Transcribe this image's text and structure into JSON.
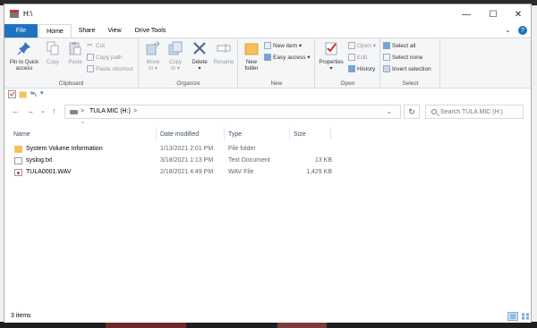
{
  "window": {
    "title": "H:\\",
    "controls": {
      "minimize": "—",
      "maximize": "☐",
      "close": "✕"
    }
  },
  "ribbon_tabs": {
    "file": "File",
    "home": "Home",
    "share": "Share",
    "view": "View",
    "drive_tools": "Drive Tools"
  },
  "ribbon": {
    "clipboard": {
      "label": "Clipboard",
      "pin_line1": "Pin to Quick",
      "pin_line2": "access",
      "copy": "Copy",
      "paste": "Paste",
      "cut": "Cut",
      "copy_path": "Copy path",
      "paste_shortcut": "Paste shortcut"
    },
    "organize": {
      "label": "Organize",
      "move_line1": "Move",
      "move_line2": "to ▾",
      "copy_line1": "Copy",
      "copy_line2": "to ▾",
      "delete_line1": "Delete",
      "delete_line2": "▾",
      "rename": "Rename"
    },
    "new": {
      "label": "New",
      "new_folder_line1": "New",
      "new_folder_line2": "folder",
      "new_item": "New item ▾",
      "easy_access": "Easy access ▾"
    },
    "open": {
      "label": "Open",
      "properties_line1": "Properties",
      "properties_line2": "▾",
      "open": "Open ▾",
      "edit": "Edit",
      "history": "History"
    },
    "select": {
      "label": "Select",
      "select_all": "Select all",
      "select_none": "Select none",
      "invert": "Invert selection"
    }
  },
  "address": {
    "path": "TULA MIC (H:)",
    "search_placeholder": "Search TULA MIC (H:)"
  },
  "columns": {
    "name": "Name",
    "date": "Date modified",
    "type": "Type",
    "size": "Size"
  },
  "files": [
    {
      "name": "System Volume Information",
      "date": "1/13/2021 2:01 PM",
      "type": "File folder",
      "size": "",
      "icon": "folder-icon"
    },
    {
      "name": "syslog.txt",
      "date": "3/18/2021 1:13 PM",
      "type": "Text Document",
      "size": "13 KB",
      "icon": "text-file-icon"
    },
    {
      "name": "TULA0001.WAV",
      "date": "2/18/2021 4:49 PM",
      "type": "WAV File",
      "size": "1,429 KB",
      "icon": "audio-file-icon"
    }
  ],
  "status": {
    "item_count": "3 items"
  },
  "colors": {
    "accent": "#1e73be",
    "header_text": "#3a4e6b",
    "folder": "#f4c25a"
  }
}
